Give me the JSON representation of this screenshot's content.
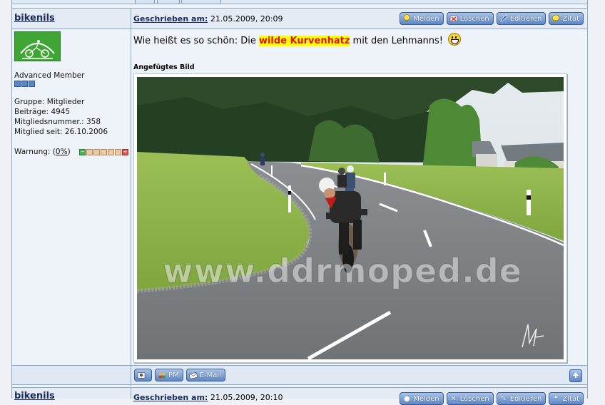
{
  "post": {
    "username": "bikenils",
    "posted_label": "Geschrieben am:",
    "posted_date": "21.05.2009, 20:09",
    "buttons": [
      {
        "label": "Melden",
        "icon": "lightbulb-icon"
      },
      {
        "label": "Löschen",
        "icon": "delete-icon"
      },
      {
        "label": "Editieren",
        "icon": "pencil-icon"
      },
      {
        "label": "Zitat",
        "icon": "quote-icon"
      }
    ],
    "user_info": {
      "rank": "Advanced Member",
      "group": "Gruppe: Mitglieder",
      "posts": "Beiträge: 4945",
      "member_no": "Mitgliedsnummer.: 358",
      "member_since": "Mitglied seit: 26.10.2006",
      "warning_label": "Warnung: (",
      "warning_value": "0%",
      "warning_close": ")"
    },
    "message": {
      "before": "Wie heißt es so schön: Die ",
      "highlight": "wilde Kurvenhatz",
      "after": " mit den Lehmanns! "
    },
    "attachment_label": "Angefügtes Bild",
    "watermark": "www.ddrmoped.de",
    "footer_buttons": [
      {
        "label": "",
        "icon": "user-profile-icon"
      },
      {
        "label": "PM",
        "icon": "users-icon"
      },
      {
        "label": "E-Mail",
        "icon": "email-icon"
      }
    ],
    "top_icon": "arrow-up-icon"
  },
  "next_post": {
    "username": "bikenils",
    "posted_label": "Geschrieben am:",
    "posted_date": "21.05.2009, 20:10"
  },
  "colors": {
    "border": "#8aa8c8",
    "header_bg": "#e4ebf5",
    "button_blue": "#5d86c6",
    "highlight_bg": "#ffff00",
    "highlight_text": "#e0121b"
  }
}
